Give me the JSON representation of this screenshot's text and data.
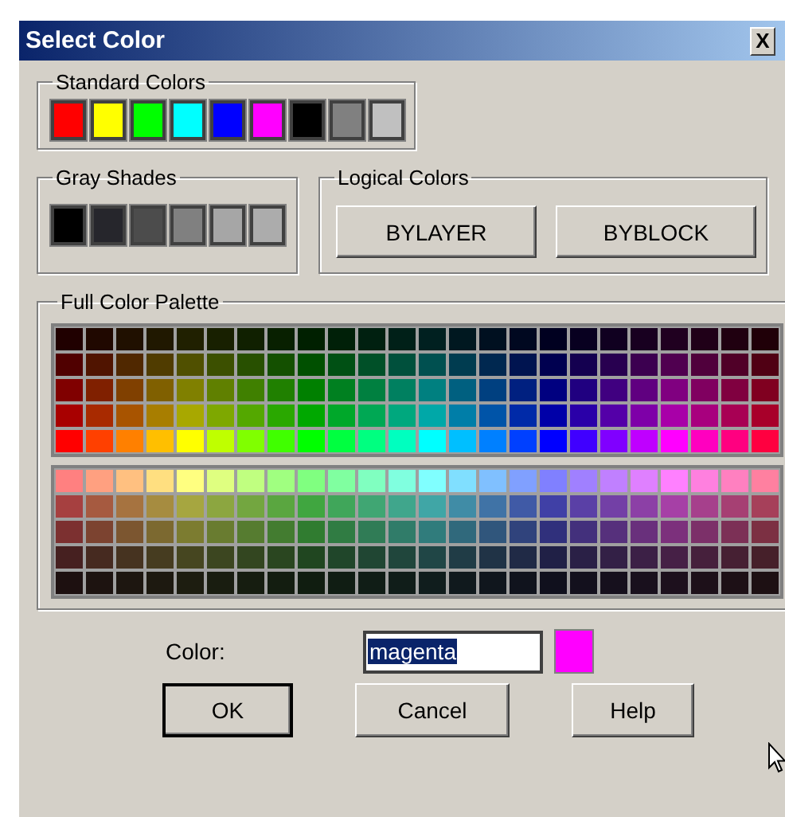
{
  "window": {
    "title": "Select Color",
    "close_label": "X"
  },
  "standard_colors": {
    "label": "Standard Colors",
    "swatches": [
      {
        "color": "#ff0000"
      },
      {
        "color": "#ffff00"
      },
      {
        "color": "#00ff00"
      },
      {
        "color": "#00ffff"
      },
      {
        "color": "#0000ff"
      },
      {
        "color": "#ff00ff"
      },
      {
        "color": "#000000"
      },
      {
        "color": "#808080"
      },
      {
        "color": "#c0c0c0"
      }
    ]
  },
  "gray_shades": {
    "label": "Gray Shades",
    "swatches": [
      {
        "color": "#000000"
      },
      {
        "color": "#26262c"
      },
      {
        "color": "#4c4c4c"
      },
      {
        "color": "#808080"
      },
      {
        "color": "#a6a6a6"
      },
      {
        "color": "#acacac"
      }
    ]
  },
  "logical_colors": {
    "label": "Logical Colors",
    "buttons": [
      "BYLAYER",
      "BYBLOCK"
    ]
  },
  "full_palette": {
    "label": "Full Color Palette",
    "blocks": [
      [
        [
          {
            "color": "#200000"
          },
          {
            "color": "#200800"
          },
          {
            "color": "#201000"
          },
          {
            "color": "#201800"
          },
          {
            "color": "#202000"
          },
          {
            "color": "#182000"
          },
          {
            "color": "#102000"
          },
          {
            "color": "#082000"
          },
          {
            "color": "#002000"
          },
          {
            "color": "#002008"
          },
          {
            "color": "#002010"
          },
          {
            "color": "#002018"
          },
          {
            "color": "#002020"
          },
          {
            "color": "#001820"
          },
          {
            "color": "#001020"
          },
          {
            "color": "#000820"
          },
          {
            "color": "#000020"
          },
          {
            "color": "#080020"
          },
          {
            "color": "#100020"
          },
          {
            "color": "#180020"
          },
          {
            "color": "#200020"
          },
          {
            "color": "#200018"
          },
          {
            "color": "#200010"
          },
          {
            "color": "#200008"
          }
        ],
        [
          {
            "color": "#500000"
          },
          {
            "color": "#501400"
          },
          {
            "color": "#502800"
          },
          {
            "color": "#503c00"
          },
          {
            "color": "#505000"
          },
          {
            "color": "#3c5000"
          },
          {
            "color": "#285000"
          },
          {
            "color": "#145000"
          },
          {
            "color": "#005000"
          },
          {
            "color": "#005014"
          },
          {
            "color": "#005028"
          },
          {
            "color": "#00503c"
          },
          {
            "color": "#005050"
          },
          {
            "color": "#003c50"
          },
          {
            "color": "#002850"
          },
          {
            "color": "#001450"
          },
          {
            "color": "#000050"
          },
          {
            "color": "#140050"
          },
          {
            "color": "#280050"
          },
          {
            "color": "#3c0050"
          },
          {
            "color": "#500050"
          },
          {
            "color": "#50003c"
          },
          {
            "color": "#500028"
          },
          {
            "color": "#500014"
          }
        ],
        [
          {
            "color": "#800000"
          },
          {
            "color": "#802000"
          },
          {
            "color": "#804000"
          },
          {
            "color": "#806000"
          },
          {
            "color": "#808000"
          },
          {
            "color": "#608000"
          },
          {
            "color": "#408000"
          },
          {
            "color": "#208000"
          },
          {
            "color": "#008000"
          },
          {
            "color": "#008020"
          },
          {
            "color": "#008040"
          },
          {
            "color": "#008060"
          },
          {
            "color": "#008080"
          },
          {
            "color": "#006080"
          },
          {
            "color": "#004080"
          },
          {
            "color": "#002080"
          },
          {
            "color": "#000080"
          },
          {
            "color": "#200080"
          },
          {
            "color": "#400080"
          },
          {
            "color": "#600080"
          },
          {
            "color": "#800080"
          },
          {
            "color": "#800060"
          },
          {
            "color": "#800040"
          },
          {
            "color": "#800020"
          }
        ],
        [
          {
            "color": "#a80000"
          },
          {
            "color": "#a82a00"
          },
          {
            "color": "#a85400"
          },
          {
            "color": "#a87e00"
          },
          {
            "color": "#a8a800"
          },
          {
            "color": "#7ea800"
          },
          {
            "color": "#54a800"
          },
          {
            "color": "#2aa800"
          },
          {
            "color": "#00a800"
          },
          {
            "color": "#00a82a"
          },
          {
            "color": "#00a854"
          },
          {
            "color": "#00a87e"
          },
          {
            "color": "#00a8a8"
          },
          {
            "color": "#007ea8"
          },
          {
            "color": "#0054a8"
          },
          {
            "color": "#002aa8"
          },
          {
            "color": "#0000a8"
          },
          {
            "color": "#2a00a8"
          },
          {
            "color": "#5400a8"
          },
          {
            "color": "#7e00a8"
          },
          {
            "color": "#a800a8"
          },
          {
            "color": "#a8007e"
          },
          {
            "color": "#a80054"
          },
          {
            "color": "#a8002a"
          }
        ],
        [
          {
            "color": "#ff0000"
          },
          {
            "color": "#ff4000"
          },
          {
            "color": "#ff8000"
          },
          {
            "color": "#ffbf00"
          },
          {
            "color": "#ffff00"
          },
          {
            "color": "#bfff00"
          },
          {
            "color": "#80ff00"
          },
          {
            "color": "#40ff00"
          },
          {
            "color": "#00ff00"
          },
          {
            "color": "#00ff40"
          },
          {
            "color": "#00ff80"
          },
          {
            "color": "#00ffbf"
          },
          {
            "color": "#00ffff"
          },
          {
            "color": "#00bfff"
          },
          {
            "color": "#0080ff"
          },
          {
            "color": "#0040ff"
          },
          {
            "color": "#0000ff"
          },
          {
            "color": "#4000ff"
          },
          {
            "color": "#8000ff"
          },
          {
            "color": "#bf00ff"
          },
          {
            "color": "#ff00ff"
          },
          {
            "color": "#ff00bf"
          },
          {
            "color": "#ff0080"
          },
          {
            "color": "#ff0040"
          }
        ]
      ],
      [
        [
          {
            "color": "#ff8080"
          },
          {
            "color": "#ffa080"
          },
          {
            "color": "#ffc080"
          },
          {
            "color": "#ffdf80"
          },
          {
            "color": "#ffff80"
          },
          {
            "color": "#dfff80"
          },
          {
            "color": "#c0ff80"
          },
          {
            "color": "#a0ff80"
          },
          {
            "color": "#80ff80"
          },
          {
            "color": "#80ffa0"
          },
          {
            "color": "#80ffc0"
          },
          {
            "color": "#80ffdf"
          },
          {
            "color": "#80ffff"
          },
          {
            "color": "#80dfff"
          },
          {
            "color": "#80c0ff"
          },
          {
            "color": "#80a0ff"
          },
          {
            "color": "#8080ff"
          },
          {
            "color": "#a080ff"
          },
          {
            "color": "#c080ff"
          },
          {
            "color": "#df80ff"
          },
          {
            "color": "#ff80ff"
          },
          {
            "color": "#ff80df"
          },
          {
            "color": "#ff80c0"
          },
          {
            "color": "#ff80a0"
          }
        ],
        [
          {
            "color": "#a64040"
          },
          {
            "color": "#a65a40"
          },
          {
            "color": "#a67340"
          },
          {
            "color": "#a68c40"
          },
          {
            "color": "#a6a640"
          },
          {
            "color": "#8ca640"
          },
          {
            "color": "#73a640"
          },
          {
            "color": "#5aa640"
          },
          {
            "color": "#40a640"
          },
          {
            "color": "#40a65a"
          },
          {
            "color": "#40a673"
          },
          {
            "color": "#40a68c"
          },
          {
            "color": "#40a6a6"
          },
          {
            "color": "#408ca6"
          },
          {
            "color": "#4073a6"
          },
          {
            "color": "#405aa6"
          },
          {
            "color": "#4040a6"
          },
          {
            "color": "#5a40a6"
          },
          {
            "color": "#7340a6"
          },
          {
            "color": "#8c40a6"
          },
          {
            "color": "#a640a6"
          },
          {
            "color": "#a6408c"
          },
          {
            "color": "#a64073"
          },
          {
            "color": "#a6405a"
          }
        ],
        [
          {
            "color": "#7c3030"
          },
          {
            "color": "#7c4330"
          },
          {
            "color": "#7c5630"
          },
          {
            "color": "#7c6930"
          },
          {
            "color": "#7c7c30"
          },
          {
            "color": "#697c30"
          },
          {
            "color": "#567c30"
          },
          {
            "color": "#437c30"
          },
          {
            "color": "#307c30"
          },
          {
            "color": "#307c43"
          },
          {
            "color": "#307c56"
          },
          {
            "color": "#307c69"
          },
          {
            "color": "#307c7c"
          },
          {
            "color": "#30697c"
          },
          {
            "color": "#30567c"
          },
          {
            "color": "#30437c"
          },
          {
            "color": "#30307c"
          },
          {
            "color": "#43307c"
          },
          {
            "color": "#56307c"
          },
          {
            "color": "#69307c"
          },
          {
            "color": "#7c307c"
          },
          {
            "color": "#7c3069"
          },
          {
            "color": "#7c3056"
          },
          {
            "color": "#7c3043"
          }
        ],
        [
          {
            "color": "#462020"
          },
          {
            "color": "#462a20"
          },
          {
            "color": "#463320"
          },
          {
            "color": "#463c20"
          },
          {
            "color": "#464620"
          },
          {
            "color": "#3c4620"
          },
          {
            "color": "#334620"
          },
          {
            "color": "#2a4620"
          },
          {
            "color": "#204620"
          },
          {
            "color": "#20462a"
          },
          {
            "color": "#204633"
          },
          {
            "color": "#20463c"
          },
          {
            "color": "#204646"
          },
          {
            "color": "#203c46"
          },
          {
            "color": "#203346"
          },
          {
            "color": "#202a46"
          },
          {
            "color": "#202046"
          },
          {
            "color": "#2a2046"
          },
          {
            "color": "#332046"
          },
          {
            "color": "#3c2046"
          },
          {
            "color": "#462046"
          },
          {
            "color": "#46203c"
          },
          {
            "color": "#462033"
          },
          {
            "color": "#46202a"
          }
        ],
        [
          {
            "color": "#1d1010"
          },
          {
            "color": "#1d1310"
          },
          {
            "color": "#1d1610"
          },
          {
            "color": "#1d1910"
          },
          {
            "color": "#1d1d10"
          },
          {
            "color": "#191d10"
          },
          {
            "color": "#161d10"
          },
          {
            "color": "#131d10"
          },
          {
            "color": "#101d10"
          },
          {
            "color": "#101d13"
          },
          {
            "color": "#101d16"
          },
          {
            "color": "#101d19"
          },
          {
            "color": "#101d1d"
          },
          {
            "color": "#10191d"
          },
          {
            "color": "#10161d"
          },
          {
            "color": "#10131d"
          },
          {
            "color": "#10101d"
          },
          {
            "color": "#13101d"
          },
          {
            "color": "#16101d"
          },
          {
            "color": "#19101d"
          },
          {
            "color": "#1d101d"
          },
          {
            "color": "#1d1019"
          },
          {
            "color": "#1d1016"
          },
          {
            "color": "#1d1013"
          }
        ]
      ]
    ]
  },
  "color_field": {
    "label": "Color:",
    "value": "magenta",
    "text_selected": true,
    "preview": {
      "color": "#ff00ff"
    }
  },
  "buttons": [
    {
      "label": "OK",
      "default": true
    },
    {
      "label": "Cancel",
      "default": false
    },
    {
      "label": "Help",
      "default": false
    }
  ]
}
